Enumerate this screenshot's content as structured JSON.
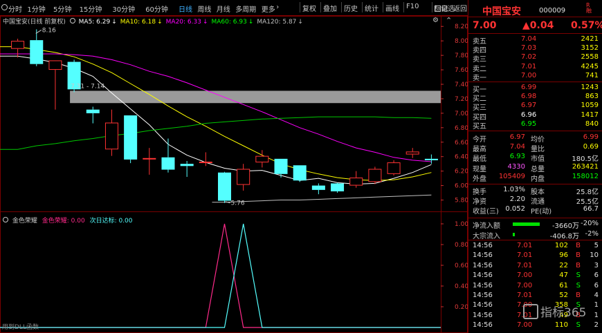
{
  "toolbar": {
    "timeframes": [
      "分时",
      "1分钟",
      "5分钟",
      "15分钟",
      "30分钟",
      "60分钟",
      "日线",
      "周线",
      "月线",
      "多周期",
      "更多"
    ],
    "active_timeframe": "日线",
    "more_caret": "›",
    "right_buttons": [
      "复权",
      "叠加",
      "历史",
      "统计",
      "画线",
      "F10",
      "标记"
    ],
    "autoselect_label": "自选",
    "back_label": "返回"
  },
  "main_chart": {
    "legend_title": "中国宝安(日线 前复权)",
    "indicators": [
      {
        "label": "MA5: 6.29",
        "color": "#ffffff"
      },
      {
        "label": "MA10: 6.18",
        "color": "#ffff00"
      },
      {
        "label": "MA20: 6.33",
        "color": "#ff00ff"
      },
      {
        "label": "MA60: 6.93",
        "color": "#00ff00"
      },
      {
        "label": "MA120: 5.87",
        "color": "#c0c0c0"
      }
    ],
    "arrow_glyph": "↓",
    "price_axis": [
      "8.20",
      "8.00",
      "7.80",
      "7.60",
      "7.40",
      "7.20",
      "7.00",
      "6.80",
      "6.60",
      "6.40",
      "6.20",
      "6.00",
      "5.80"
    ],
    "annot_high": "8.16",
    "annot_low": "5.76",
    "annot_zone": "7.31 - 7.14"
  },
  "sub_chart": {
    "name": "金色荣耀",
    "series1_label": "金色荣耀: 0.00",
    "series2_label": "次日达标: 0.00",
    "axis": [
      "1.00",
      "0.80",
      "0.60",
      "0.40",
      "0.20"
    ],
    "footer": "用到DLL函数"
  },
  "quote": {
    "name": "中国宝安",
    "code": "000009",
    "r_mark": "R",
    "r_sub": "融",
    "price": "7.00",
    "change": "▲0.04",
    "change_pct": "0.57%",
    "asks": [
      {
        "label": "卖五",
        "price": "7.04",
        "vol": "2421"
      },
      {
        "label": "卖四",
        "price": "7.03",
        "vol": "3152"
      },
      {
        "label": "卖三",
        "price": "7.02",
        "vol": "2558"
      },
      {
        "label": "卖二",
        "price": "7.01",
        "vol": "4245"
      },
      {
        "label": "卖一",
        "price": "7.00",
        "vol": "741"
      }
    ],
    "bids": [
      {
        "label": "买一",
        "price": "6.99",
        "vol": "1243",
        "color": "#ff3333"
      },
      {
        "label": "买二",
        "price": "6.98",
        "vol": "863",
        "color": "#ff3333"
      },
      {
        "label": "买三",
        "price": "6.97",
        "vol": "1059",
        "color": "#ff3333"
      },
      {
        "label": "买四",
        "price": "6.96",
        "vol": "1417",
        "color": "#ffffff"
      },
      {
        "label": "买五",
        "price": "6.95",
        "vol": "840",
        "color": "#00ff00"
      }
    ],
    "stats": [
      {
        "l1": "今开",
        "v1": "6.97",
        "c1": "#ff3333",
        "l2": "均价",
        "v2": "6.99",
        "c2": "#ff3333"
      },
      {
        "l1": "最高",
        "v1": "7.04",
        "c1": "#ff3333",
        "l2": "量比",
        "v2": "0.69",
        "c2": "#ffff00"
      },
      {
        "l1": "最低",
        "v1": "6.93",
        "c1": "#00ff00",
        "l2": "市值",
        "v2": "180.5亿",
        "c2": "#e0e0e0"
      },
      {
        "l1": "现量",
        "v1": "4330",
        "c1": "#ff55ff",
        "l2": "总量",
        "v2": "263421",
        "c2": "#ffff00"
      },
      {
        "l1": "外盘",
        "v1": "105409",
        "c1": "#ff3333",
        "l2": "内盘",
        "v2": "158012",
        "c2": "#00ff00"
      }
    ],
    "stats2": [
      {
        "l1": "换手",
        "v1": "1.03%",
        "l2": "股本",
        "v2": "25.8亿"
      },
      {
        "l1": "净资",
        "v1": "2.20",
        "l2": "流通",
        "v2": "25.5亿"
      },
      {
        "l1": "收益(三)",
        "v1": "0.052",
        "l2": "PE(动)",
        "v2": "66.7"
      }
    ],
    "flows": [
      {
        "label": "净流入额",
        "value": "-3660万",
        "pct": "-20%",
        "bar": 0.65
      },
      {
        "label": "大宗流入",
        "value": "-406.8万",
        "pct": "-2%",
        "bar": 0.05
      }
    ],
    "trades": [
      {
        "time": "14:56",
        "price": "7.01",
        "vol": "102",
        "bs": "B",
        "n": "5"
      },
      {
        "time": "14:56",
        "price": "7.01",
        "vol": "96",
        "bs": "B",
        "n": "10"
      },
      {
        "time": "14:56",
        "price": "7.01",
        "vol": "22",
        "bs": "B",
        "n": "3"
      },
      {
        "time": "14:56",
        "price": "7.00",
        "vol": "47",
        "bs": "S",
        "n": "6"
      },
      {
        "time": "14:56",
        "price": "7.00",
        "vol": "61",
        "bs": "S",
        "n": "6"
      },
      {
        "time": "14:56",
        "price": "7.01",
        "vol": "52",
        "bs": "B",
        "n": "4"
      },
      {
        "time": "14:56",
        "price": "7.00",
        "vol": "358",
        "bs": "S",
        "n": "1"
      },
      {
        "time": "14:56",
        "price": "7.01",
        "vol": "49",
        "bs": "B",
        "n": "1"
      },
      {
        "time": "14:56",
        "price": "7.00",
        "vol": "110",
        "bs": "S",
        "n": "2"
      }
    ]
  },
  "watermark": "指标365",
  "colors": {
    "up": "#ff3333",
    "down": "#54ffff",
    "border": "#7a0000",
    "grid": "#3a0000"
  },
  "chart_data": {
    "type": "candlestick",
    "title": "中国宝安(日线 前复权)",
    "ylim": [
      5.7,
      8.25
    ],
    "candles": [
      {
        "o": 7.89,
        "h": 8.03,
        "l": 7.77,
        "c": 8.0
      },
      {
        "o": 8.01,
        "h": 8.16,
        "l": 7.65,
        "c": 7.68
      },
      {
        "o": 7.6,
        "h": 7.72,
        "l": 7.05,
        "c": 7.73
      },
      {
        "o": 7.71,
        "h": 7.74,
        "l": 7.29,
        "c": 7.33
      },
      {
        "o": 7.05,
        "h": 7.09,
        "l": 6.86,
        "c": 7.0
      },
      {
        "o": 6.5,
        "h": 7.05,
        "l": 6.41,
        "c": 6.87
      },
      {
        "o": 6.97,
        "h": 6.97,
        "l": 6.31,
        "c": 6.36
      },
      {
        "o": 6.38,
        "h": 6.52,
        "l": 6.15,
        "c": 6.38
      },
      {
        "o": 6.39,
        "h": 6.65,
        "l": 6.18,
        "c": 6.22
      },
      {
        "o": 6.3,
        "h": 6.34,
        "l": 6.12,
        "c": 6.27
      },
      {
        "o": 6.33,
        "h": 6.46,
        "l": 6.27,
        "c": 6.33
      },
      {
        "o": 6.18,
        "h": 6.19,
        "l": 5.76,
        "c": 5.79
      },
      {
        "o": 6.01,
        "h": 6.3,
        "l": 5.93,
        "c": 6.23
      },
      {
        "o": 6.32,
        "h": 6.49,
        "l": 6.25,
        "c": 6.41
      },
      {
        "o": 6.37,
        "h": 6.37,
        "l": 6.11,
        "c": 6.16
      },
      {
        "o": 6.28,
        "h": 6.28,
        "l": 6.05,
        "c": 6.07
      },
      {
        "o": 6.0,
        "h": 6.03,
        "l": 5.88,
        "c": 5.94
      },
      {
        "o": 6.03,
        "h": 6.04,
        "l": 5.9,
        "c": 5.92
      },
      {
        "o": 6.0,
        "h": 6.2,
        "l": 5.97,
        "c": 6.11
      },
      {
        "o": 6.05,
        "h": 6.26,
        "l": 6.02,
        "c": 6.23
      },
      {
        "o": 6.16,
        "h": 6.35,
        "l": 6.14,
        "c": 6.32
      },
      {
        "o": 6.43,
        "h": 6.52,
        "l": 6.38,
        "c": 6.47
      },
      {
        "o": 6.37,
        "h": 6.43,
        "l": 6.3,
        "c": 6.35
      }
    ],
    "series": [
      {
        "name": "MA5",
        "values": [
          7.79,
          7.75,
          7.7,
          7.62,
          7.51,
          7.28,
          7.06,
          6.84,
          6.57,
          6.42,
          6.32,
          6.24,
          6.2,
          6.21,
          6.14,
          6.07,
          6.1,
          6.04,
          6.02,
          6.03,
          6.1,
          6.18,
          6.29
        ]
      },
      {
        "name": "MA10",
        "values": [
          7.92,
          7.88,
          7.84,
          7.78,
          7.68,
          7.56,
          7.41,
          7.26,
          7.1,
          6.95,
          6.82,
          6.68,
          6.55,
          6.42,
          6.3,
          6.22,
          6.16,
          6.11,
          6.08,
          6.07,
          6.08,
          6.12,
          6.18
        ]
      },
      {
        "name": "MA20",
        "values": [
          7.82,
          7.82,
          7.82,
          7.81,
          7.79,
          7.74,
          7.67,
          7.58,
          7.51,
          7.42,
          7.32,
          7.22,
          7.12,
          7.02,
          6.91,
          6.8,
          6.71,
          6.61,
          6.52,
          6.46,
          6.39,
          6.35,
          6.33
        ]
      },
      {
        "name": "MA60",
        "values": [
          6.5,
          6.55,
          6.58,
          6.62,
          6.65,
          6.69,
          6.72,
          6.76,
          6.79,
          6.82,
          6.86,
          6.88,
          6.9,
          6.92,
          6.93,
          6.94,
          6.95,
          6.95,
          6.95,
          6.95,
          6.94,
          6.94,
          6.93
        ]
      },
      {
        "name": "MA120",
        "values": [
          null,
          null,
          null,
          null,
          null,
          null,
          null,
          null,
          null,
          null,
          null,
          5.77,
          5.78,
          5.79,
          5.8,
          5.8,
          5.81,
          5.82,
          5.83,
          5.84,
          5.85,
          5.86,
          5.87
        ]
      }
    ],
    "zone": [
      7.14,
      7.31
    ],
    "zone_start_index": 3,
    "sub_series": [
      {
        "name": "金色荣耀",
        "values": [
          0,
          0,
          0,
          0,
          0,
          0,
          0,
          0,
          0,
          0,
          0,
          1,
          0,
          0,
          0,
          0,
          0,
          0,
          0,
          0,
          0,
          0,
          0
        ]
      },
      {
        "name": "次日达标",
        "values": [
          0,
          0,
          0,
          0,
          0,
          0,
          0,
          0,
          0,
          0,
          0,
          0,
          1,
          0,
          0,
          0,
          0,
          0,
          0,
          0,
          0,
          0,
          0
        ]
      }
    ]
  }
}
